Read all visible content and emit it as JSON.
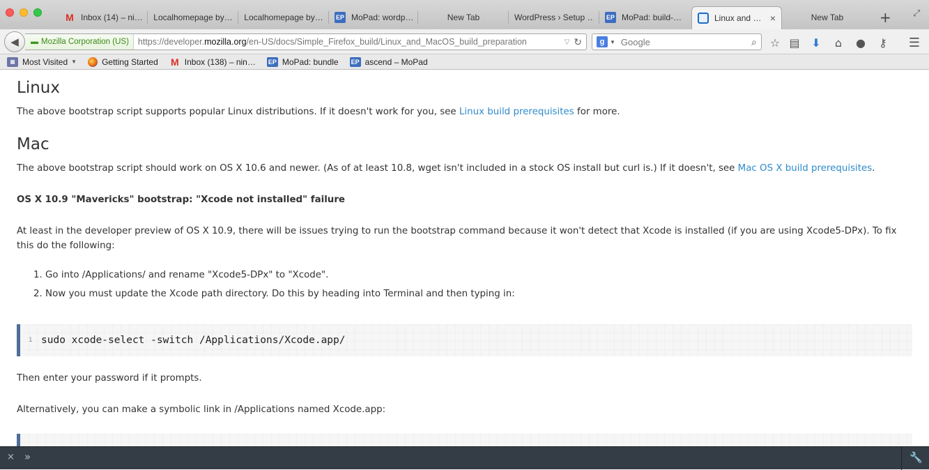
{
  "tabs": [
    {
      "label": "Inbox (14) – ni…",
      "favicon": "gmail-icon"
    },
    {
      "label": "Localhomepage by…",
      "favicon": ""
    },
    {
      "label": "Localhomepage by…",
      "favicon": ""
    },
    {
      "label": "MoPad: wordp…",
      "favicon": "ep-icon"
    },
    {
      "label": "New Tab",
      "favicon": ""
    },
    {
      "label": "WordPress › Setup …",
      "favicon": ""
    },
    {
      "label": "MoPad: build-…",
      "favicon": "ep-icon"
    },
    {
      "label": "Linux and …",
      "favicon": "mdn-icon",
      "active": true
    },
    {
      "label": "New Tab",
      "favicon": ""
    }
  ],
  "navbar": {
    "identity": "Mozilla Corporation (US)",
    "url_prefix": "https://developer.",
    "url_domain": "mozilla.org",
    "url_path": "/en-US/docs/Simple_Firefox_build/Linux_and_MacOS_build_preparation",
    "search_engine": "g",
    "search_placeholder": "Google"
  },
  "bookmarks": [
    {
      "label": "Most Visited",
      "icon": "folder-icon"
    },
    {
      "label": "Getting Started",
      "icon": "firefox-icon"
    },
    {
      "label": "Inbox (138) – nin…",
      "icon": "gmail-icon"
    },
    {
      "label": "MoPad: bundle",
      "icon": "ep-icon"
    },
    {
      "label": "ascend – MoPad",
      "icon": "ep-icon"
    }
  ],
  "favicon_text": {
    "gmail": "M",
    "ep": "EP"
  },
  "content": {
    "linux_heading": "Linux",
    "linux_text_before": "The above bootstrap script supports popular Linux distributions. If it doesn't work for you, see ",
    "linux_link": "Linux build prerequisites",
    "linux_text_after": " for more.",
    "mac_heading": "Mac",
    "mac_text_before": "The above bootstrap script should work on OS X 10.6 and newer. (As of at least 10.8, wget isn't included in a stock OS install but curl is.) If it doesn't, see ",
    "mac_link": "Mac OS X build prerequisites",
    "mac_text_after": ".",
    "mavericks_heading": "OS X 10.9 \"Mavericks\" bootstrap: \"Xcode not installed\" failure",
    "mavericks_text": "At least in the developer preview of OS X 10.9, there will be issues trying to run the bootstrap command because it won't detect that Xcode is installed (if you are using Xcode5-DPx). To fix this do the following:",
    "steps": [
      "Go into /Applications/ and rename \"Xcode5-DPx\" to \"Xcode\".",
      "Now you must update the Xcode path directory. Do this by heading into Terminal and then typing in:"
    ],
    "step_numbers": [
      "1.",
      "2."
    ],
    "code_line_number": "1",
    "code": "sudo xcode-select -switch /Applications/Xcode.app/",
    "password_text": "Then enter your password if it prompts.",
    "symlink_text": "Alternatively, you can make a symbolic link in /Applications named Xcode.app:"
  },
  "devtoolbar": {
    "close": "×",
    "prompt": "»",
    "input_value": ""
  }
}
